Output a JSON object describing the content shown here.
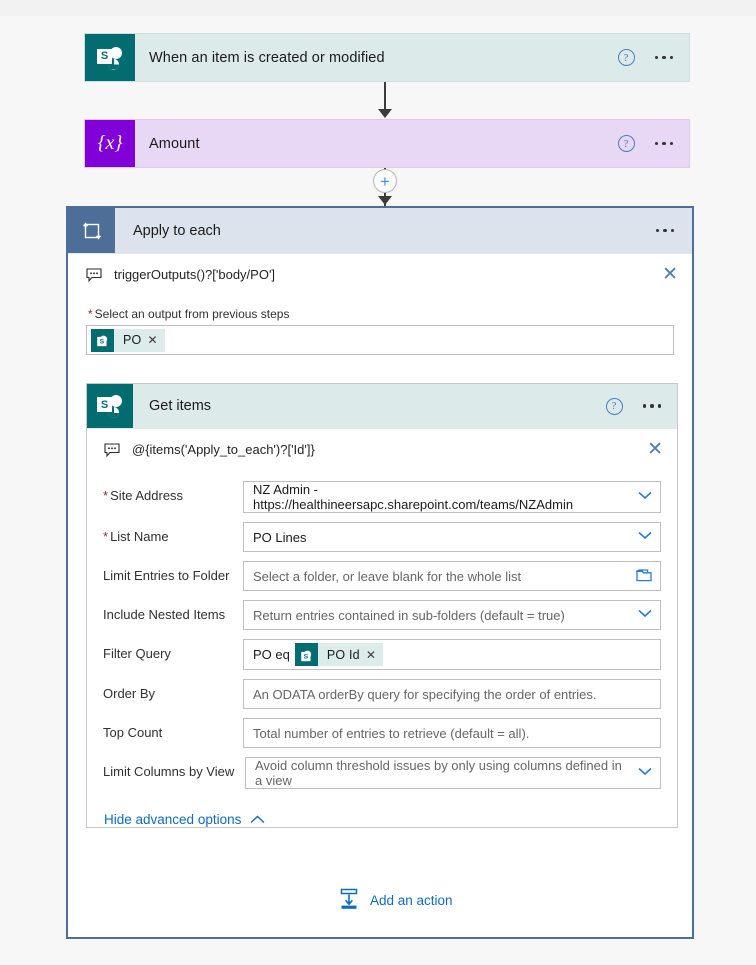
{
  "flow": {
    "trigger": {
      "title": "When an item is created or modified",
      "icon": "sharepoint-icon",
      "help_label": "?",
      "menu_label": "..."
    },
    "variable_step": {
      "title": "Amount",
      "icon": "variable-icon",
      "glyph": "{x}",
      "help_label": "?",
      "menu_label": "..."
    },
    "add_step_button": {
      "label": "+",
      "icon": "plus-icon"
    },
    "scope": {
      "title": "Apply to each",
      "icon": "loop-icon",
      "menu_label": "...",
      "expression": {
        "icon": "expression-icon",
        "text": "triggerOutputs()?['body/PO']",
        "clear_label": "✕"
      },
      "output_field": {
        "label": "Select an output from previous steps",
        "required_marker": "*",
        "token": {
          "icon": "sharepoint-icon",
          "text": "PO",
          "remove_label": "✕"
        }
      },
      "add_action": {
        "label": "Add an action",
        "icon": "add-action-icon"
      }
    },
    "action": {
      "title": "Get items",
      "icon": "sharepoint-icon",
      "help_label": "?",
      "menu_label": "...",
      "expression": {
        "icon": "expression-icon",
        "text": "@{items('Apply_to_each')?['Id']}",
        "clear_label": "✕"
      },
      "fields": [
        {
          "label": "Site Address",
          "required": true,
          "value": "NZ Admin - https://healthineersapc.sharepoint.com/teams/NZAdmin",
          "placeholder": "",
          "control": "dropdown",
          "is_placeholder": false
        },
        {
          "label": "List Name",
          "required": true,
          "value": "PO Lines",
          "placeholder": "",
          "control": "dropdown",
          "is_placeholder": false
        },
        {
          "label": "Limit Entries to Folder",
          "required": false,
          "value": "",
          "placeholder": "Select a folder, or leave blank for the whole list",
          "control": "folder-picker",
          "is_placeholder": true
        },
        {
          "label": "Include Nested Items",
          "required": false,
          "value": "",
          "placeholder": "Return entries contained in sub-folders (default = true)",
          "control": "dropdown",
          "is_placeholder": true
        },
        {
          "label": "Filter Query",
          "required": false,
          "value": "PO eq",
          "placeholder": "",
          "control": "token-text",
          "is_placeholder": false,
          "token": {
            "icon": "sharepoint-icon",
            "text": "PO Id",
            "remove_label": "✕"
          }
        },
        {
          "label": "Order By",
          "required": false,
          "value": "",
          "placeholder": "An ODATA orderBy query for specifying the order of entries.",
          "control": "text",
          "is_placeholder": true
        },
        {
          "label": "Top Count",
          "required": false,
          "value": "",
          "placeholder": "Total number of entries to retrieve (default = all).",
          "control": "text",
          "is_placeholder": true
        },
        {
          "label": "Limit Columns by View",
          "required": false,
          "value": "",
          "placeholder": "Avoid column threshold issues by only using columns defined in a view",
          "control": "dropdown",
          "is_placeholder": true
        }
      ],
      "advanced_toggle": {
        "label": "Hide advanced options",
        "icon": "chevron-up-icon"
      }
    }
  },
  "colors": {
    "sharepoint_teal": "#036c70",
    "variable_purple": "#8000d7",
    "scope_blue": "#4d6e96",
    "link_blue": "#0f6cbd",
    "required_red": "#a4262c",
    "trigger_header": "#dceaea",
    "variable_header": "#e9d8f5",
    "scope_header": "#dde3ec"
  }
}
